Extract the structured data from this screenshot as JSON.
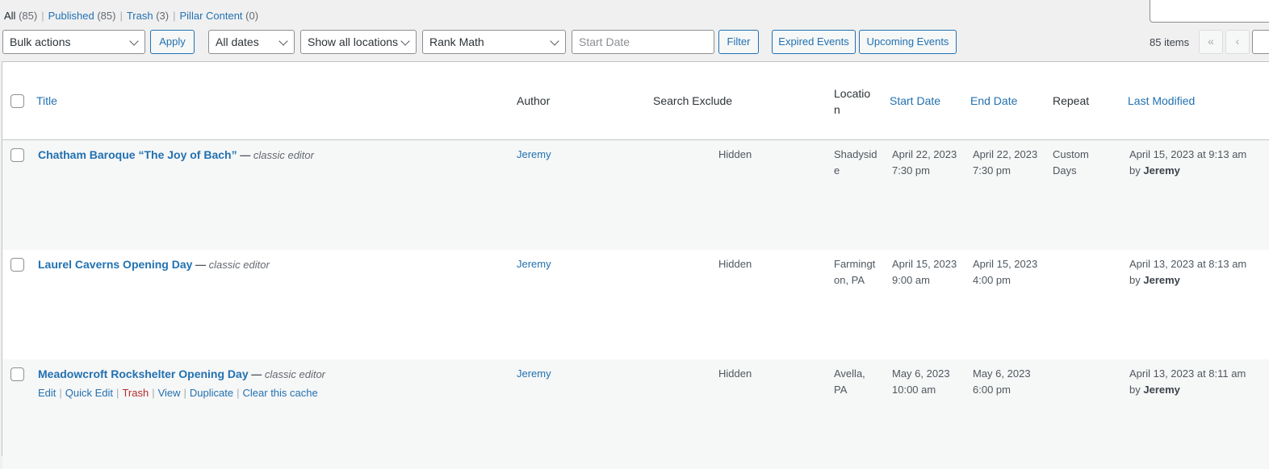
{
  "status_filters": [
    {
      "label": "All",
      "count": "(85)",
      "current": true
    },
    {
      "label": "Published",
      "count": "(85)",
      "current": false
    },
    {
      "label": "Trash",
      "count": "(3)",
      "current": false
    },
    {
      "label": "Pillar Content",
      "count": "(0)",
      "current": false
    }
  ],
  "tablenav": {
    "bulk_actions": "Bulk actions",
    "apply": "Apply",
    "dates": "All dates",
    "locations": "Show all locations",
    "seo": "Rank Math",
    "start_date_placeholder": "Start Date",
    "filter": "Filter",
    "expired": "Expired Events",
    "upcoming": "Upcoming Events",
    "items_count": "85 items",
    "first_page": "«",
    "prev_page": "‹"
  },
  "columns": {
    "title": "Title",
    "author": "Author",
    "search_exclude": "Search Exclude",
    "location_line1": "Locatio",
    "location_line2": "n",
    "start_date": "Start Date",
    "end_date": "End Date",
    "repeat": "Repeat",
    "last_modified": "Last Modified"
  },
  "rows": [
    {
      "title": "Chatham Baroque “The Joy of Bach”",
      "dash": "—",
      "state": "classic editor",
      "author": "Jeremy",
      "search_exclude": "Hidden",
      "location_line1": "Shadysid",
      "location_line2": "e",
      "start_line1": "April 22, 2023",
      "start_line2": "7:30 pm",
      "end_line1": "April 22, 2023",
      "end_line2": "7:30 pm",
      "repeat_line1": "Custom",
      "repeat_line2": "Days",
      "modified": "April 15, 2023 at 9:13 am",
      "by": "by",
      "by_name": "Jeremy"
    },
    {
      "title": "Laurel Caverns Opening Day",
      "dash": "—",
      "state": "classic editor",
      "author": "Jeremy",
      "search_exclude": "Hidden",
      "location_line1": "Farmingt",
      "location_line2": "on, PA",
      "start_line1": "April 15, 2023",
      "start_line2": "9:00 am",
      "end_line1": "April 15, 2023",
      "end_line2": "4:00 pm",
      "repeat_line1": "",
      "repeat_line2": "",
      "modified": "April 13, 2023 at 8:13 am",
      "by": "by",
      "by_name": "Jeremy"
    },
    {
      "title": "Meadowcroft Rockshelter Opening Day",
      "dash": "—",
      "state": "classic editor",
      "author": "Jeremy",
      "search_exclude": "Hidden",
      "location_line1": "Avella,",
      "location_line2": "PA",
      "start_line1": "May 6, 2023",
      "start_line2": "10:00 am",
      "end_line1": "May 6, 2023",
      "end_line2": "6:00 pm",
      "repeat_line1": "",
      "repeat_line2": "",
      "modified": "April 13, 2023 at 8:11 am",
      "by": "by",
      "by_name": "Jeremy",
      "actions": {
        "edit": "Edit",
        "quick_edit": "Quick Edit",
        "trash": "Trash",
        "view": "View",
        "duplicate": "Duplicate",
        "clear_cache": "Clear this cache",
        "sep": "|"
      }
    }
  ]
}
